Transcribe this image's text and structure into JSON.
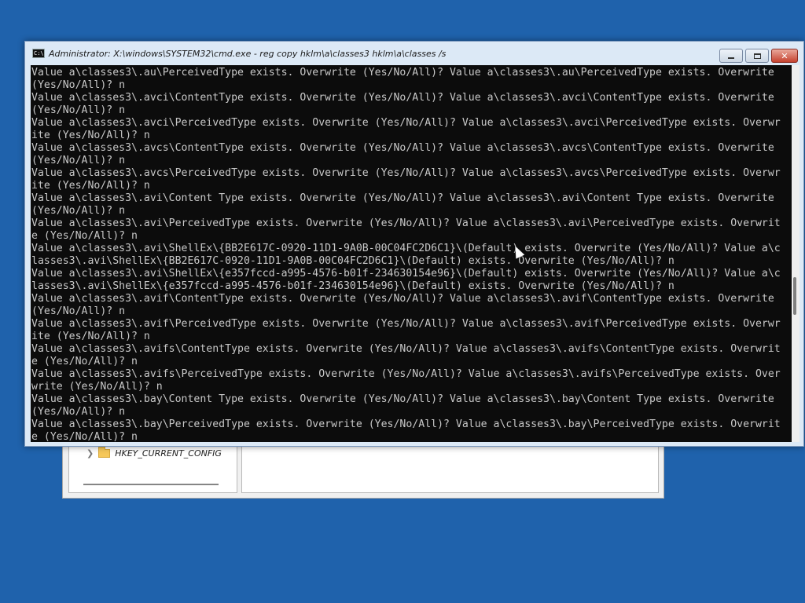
{
  "background_color": "#1f62ac",
  "regedit": {
    "tree_item": "HKEY_CURRENT_CONFIG",
    "chevron_icon": "chevron-right-icon",
    "folder_icon": "folder-icon"
  },
  "cmd": {
    "title": "Administrator: X:\\windows\\SYSTEM32\\cmd.exe - reg  copy hklm\\a\\classes3 hklm\\a\\classes /s",
    "icon": "cmd-icon",
    "buttons": {
      "minimize": "minimize-icon",
      "maximize": "maximize-icon",
      "close": "close-icon"
    },
    "console_lines": [
      "Value a\\classes3\\.au\\PerceivedType exists. Overwrite (Yes/No/All)? Value a\\classes3\\.au\\PerceivedType exists. Overwrite",
      "(Yes/No/All)? n",
      "Value a\\classes3\\.avci\\ContentType exists. Overwrite (Yes/No/All)? Value a\\classes3\\.avci\\ContentType exists. Overwrite",
      "(Yes/No/All)? n",
      "Value a\\classes3\\.avci\\PerceivedType exists. Overwrite (Yes/No/All)? Value a\\classes3\\.avci\\PerceivedType exists. Overwr",
      "ite (Yes/No/All)? n",
      "Value a\\classes3\\.avcs\\ContentType exists. Overwrite (Yes/No/All)? Value a\\classes3\\.avcs\\ContentType exists. Overwrite",
      "(Yes/No/All)? n",
      "Value a\\classes3\\.avcs\\PerceivedType exists. Overwrite (Yes/No/All)? Value a\\classes3\\.avcs\\PerceivedType exists. Overwr",
      "ite (Yes/No/All)? n",
      "Value a\\classes3\\.avi\\Content Type exists. Overwrite (Yes/No/All)? Value a\\classes3\\.avi\\Content Type exists. Overwrite",
      "(Yes/No/All)? n",
      "Value a\\classes3\\.avi\\PerceivedType exists. Overwrite (Yes/No/All)? Value a\\classes3\\.avi\\PerceivedType exists. Overwrit",
      "e (Yes/No/All)? n",
      "Value a\\classes3\\.avi\\ShellEx\\{BB2E617C-0920-11D1-9A0B-00C04FC2D6C1}\\(Default) exists. Overwrite (Yes/No/All)? Value a\\c",
      "lasses3\\.avi\\ShellEx\\{BB2E617C-0920-11D1-9A0B-00C04FC2D6C1}\\(Default) exists. Overwrite (Yes/No/All)? n",
      "Value a\\classes3\\.avi\\ShellEx\\{e357fccd-a995-4576-b01f-234630154e96}\\(Default) exists. Overwrite (Yes/No/All)? Value a\\c",
      "lasses3\\.avi\\ShellEx\\{e357fccd-a995-4576-b01f-234630154e96}\\(Default) exists. Overwrite (Yes/No/All)? n",
      "Value a\\classes3\\.avif\\ContentType exists. Overwrite (Yes/No/All)? Value a\\classes3\\.avif\\ContentType exists. Overwrite",
      "(Yes/No/All)? n",
      "Value a\\classes3\\.avif\\PerceivedType exists. Overwrite (Yes/No/All)? Value a\\classes3\\.avif\\PerceivedType exists. Overwr",
      "ite (Yes/No/All)? n",
      "Value a\\classes3\\.avifs\\ContentType exists. Overwrite (Yes/No/All)? Value a\\classes3\\.avifs\\ContentType exists. Overwrit",
      "e (Yes/No/All)? n",
      "Value a\\classes3\\.avifs\\PerceivedType exists. Overwrite (Yes/No/All)? Value a\\classes3\\.avifs\\PerceivedType exists. Over",
      "write (Yes/No/All)? n",
      "Value a\\classes3\\.bay\\Content Type exists. Overwrite (Yes/No/All)? Value a\\classes3\\.bay\\Content Type exists. Overwrite",
      "(Yes/No/All)? n",
      "Value a\\classes3\\.bay\\PerceivedType exists. Overwrite (Yes/No/All)? Value a\\classes3\\.bay\\PerceivedType exists. Overwrit",
      "e (Yes/No/All)? n"
    ]
  }
}
